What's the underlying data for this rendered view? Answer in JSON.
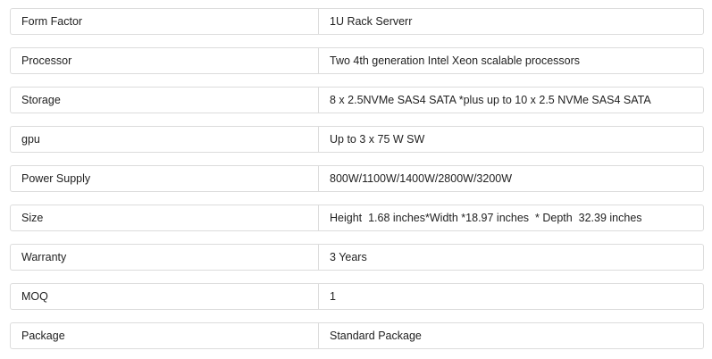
{
  "specs": {
    "rows": [
      {
        "label": "Form Factor",
        "value": "1U Rack Serverr"
      },
      {
        "label": "Processor",
        "value": "Two 4th generation Intel Xeon scalable processors"
      },
      {
        "label": "Storage",
        "value": "8 x 2.5NVMe SAS4 SATA *plus up to 10 x 2.5 NVMe SAS4 SATA"
      },
      {
        "label": "gpu",
        "value": "Up to 3 x 75 W SW"
      },
      {
        "label": "Power Supply",
        "value": "800W/1100W/1400W/2800W/3200W"
      },
      {
        "label": "Size",
        "value": "Height  1.68 inches*Width *18.97 inches  * Depth  32.39 inches"
      },
      {
        "label": "Warranty",
        "value": "3 Years"
      },
      {
        "label": "MOQ",
        "value": "1"
      },
      {
        "label": "Package",
        "value": "Standard Package"
      }
    ]
  }
}
